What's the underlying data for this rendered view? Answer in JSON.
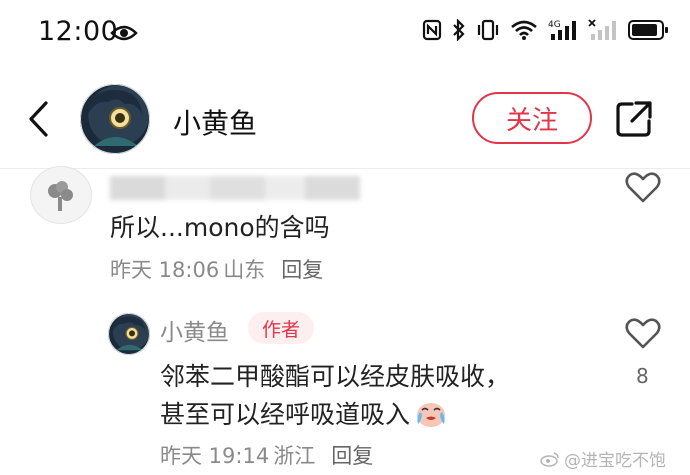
{
  "status_bar": {
    "time": "12:00"
  },
  "header": {
    "author_name": "小黄鱼",
    "follow_label": "关注"
  },
  "comments": [
    {
      "text": "所以...mono的含吗",
      "date": "昨天 18:06",
      "location": "山东",
      "reply_label": "回复"
    }
  ],
  "replies": [
    {
      "name": "小黄鱼",
      "author_badge": "作者",
      "line1": "邻苯二甲酸酯可以经皮肤吸收，",
      "line2": "甚至可以经呼吸道吸入",
      "date": "昨天 19:14",
      "location": "浙江",
      "reply_label": "回复",
      "like_count": "8"
    }
  ],
  "watermark": {
    "text": "@进宝吃不饱"
  },
  "colors": {
    "accent": "#e4344a",
    "muted_text": "#8a8a8a",
    "badge_bg": "#fdeff0"
  },
  "icons": [
    "eye-icon",
    "nfc-icon",
    "bluetooth-icon",
    "vibrate-icon",
    "wifi-icon",
    "signal-icon",
    "battery-icon",
    "back-icon",
    "share-icon",
    "heart-icon",
    "crying-emoji-icon"
  ]
}
